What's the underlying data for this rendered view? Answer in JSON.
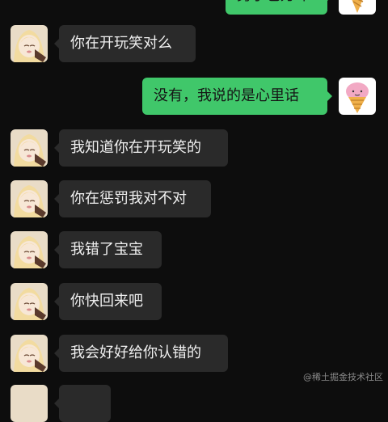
{
  "messages": [
    {
      "side": "out",
      "text": "男子也万咔"
    },
    {
      "side": "in",
      "text": "你在开玩笑对么"
    },
    {
      "side": "out",
      "text": "没有，我说的是心里话"
    },
    {
      "side": "in",
      "text": "我知道你在开玩笑的"
    },
    {
      "side": "in",
      "text": "你在惩罚我对不对"
    },
    {
      "side": "in",
      "text": "我错了宝宝"
    },
    {
      "side": "in",
      "text": "你快回来吧"
    },
    {
      "side": "in",
      "text": "我会好好给你认错的"
    }
  ],
  "watermark": "@稀土掘金技术社区",
  "avatars": {
    "partner": "anime-girl-avatar",
    "self": "ice-cream-avatar"
  }
}
